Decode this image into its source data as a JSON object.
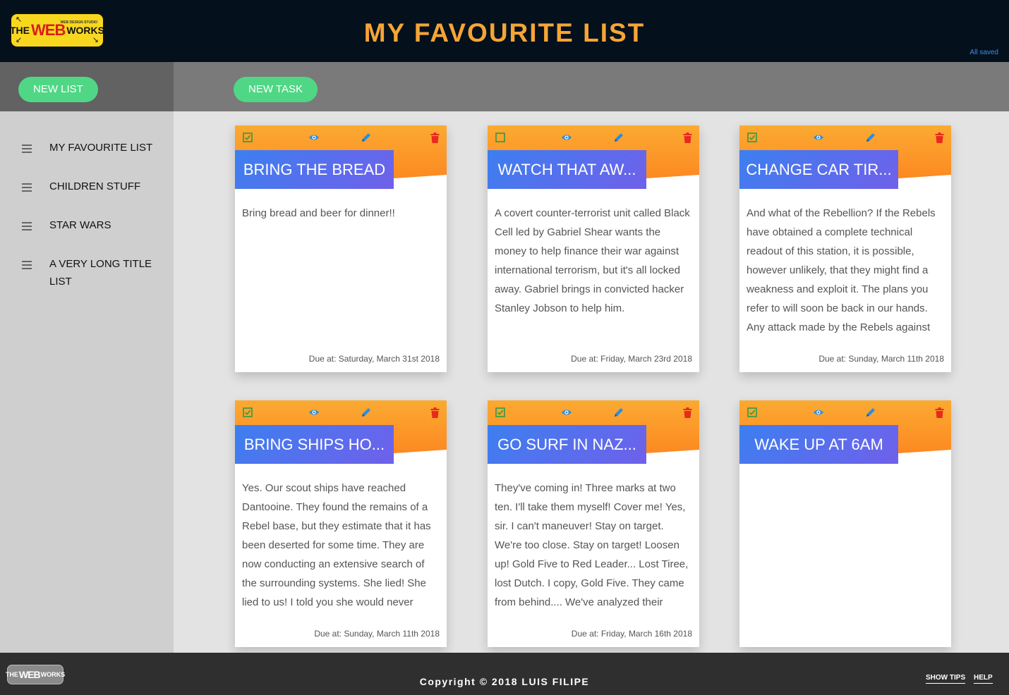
{
  "header": {
    "logo": {
      "line1": "THE",
      "line2": "WEB",
      "line3": "WORKS",
      "tagline": "WEB DESIGN STUDIO"
    },
    "title": "MY FAVOURITE LIST",
    "save_status": "All saved"
  },
  "toolbar": {
    "new_list_label": "NEW LIST",
    "new_task_label": "NEW TASK"
  },
  "sidebar": {
    "items": [
      {
        "label": "MY FAVOURITE LIST"
      },
      {
        "label": "CHILDREN STUFF"
      },
      {
        "label": "STAR WARS"
      },
      {
        "label": "A VERY LONG TITLE LIST"
      }
    ]
  },
  "tasks": [
    {
      "title": "BRING THE BREAD",
      "done": true,
      "body": "Bring bread and beer for dinner!!",
      "due": "Due at: Saturday, March 31st 2018"
    },
    {
      "title": "WATCH THAT AW...",
      "done": false,
      "body": "A covert counter-terrorist unit called Black Cell led by Gabriel Shear wants the money to help finance their war against international terrorism, but it's all locked away. Gabriel brings in convicted hacker Stanley Jobson to help him.",
      "due": "Due at: Friday, March 23rd 2018"
    },
    {
      "title": "CHANGE CAR TIR...",
      "done": true,
      "body": "And what of the Rebellion? If the Rebels have obtained a complete technical readout of this station, it is possible, however unlikely, that they might find a weakness and exploit it. The plans you refer to will soon be back in our hands. Any attack made by the Rebels against",
      "due": "Due at: Sunday, March 11th 2018"
    },
    {
      "title": "BRING SHIPS HO...",
      "done": true,
      "body": "Yes. Our scout ships have reached Dantooine. They found the remains of a Rebel base, but they estimate that it has been deserted for some time. They are now conducting an extensive search of the surrounding systems. She lied! She lied to us! I told you she would never",
      "due": "Due at: Sunday, March 11th 2018"
    },
    {
      "title": "GO SURF IN NAZ...",
      "done": true,
      "body": "They've coming in! Three marks at two ten. I'll take them myself! Cover me! Yes, sir. I can't maneuver! Stay on target. We're too close. Stay on target! Loosen up! Gold Five to Red Leader... Lost Tiree, lost Dutch. I copy, Gold Five. They came from behind.... We've analyzed their",
      "due": "Due at: Friday, March 16th 2018"
    },
    {
      "title": "WAKE UP AT 6AM",
      "done": true,
      "body": "",
      "due": ""
    }
  ],
  "icons": {
    "complete": "checkbox-icon",
    "view": "eye-icon",
    "edit": "pencil-icon",
    "delete": "trash-icon",
    "drag": "drag-handle-icon"
  },
  "colors": {
    "accent_title": "#f5a535",
    "button_green": "#4fd785",
    "card_orange": "#fd8a22",
    "card_blue": "#3c7ff0",
    "delete_red": "#e8291c",
    "icon_blue": "#2a8de0",
    "checkbox_green": "#2e9b45"
  },
  "footer": {
    "logo": {
      "line1": "THE",
      "line2": "WEB",
      "line3": "WORKS"
    },
    "copyright": "Copyright © 2018 LUIS FILIPE",
    "show_tips_label": "SHOW TIPS",
    "help_label": "HELP"
  }
}
